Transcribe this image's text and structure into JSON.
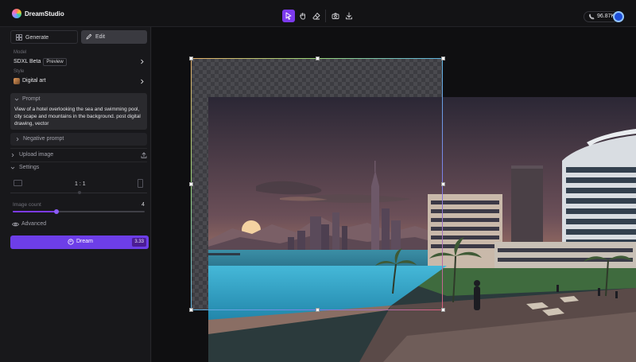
{
  "app": {
    "name": "DreamStudio"
  },
  "toolbar": {
    "tools": [
      {
        "name": "select-tool",
        "icon": "cursor-icon",
        "active": true
      },
      {
        "name": "pan-tool",
        "icon": "hand-icon",
        "active": false
      },
      {
        "name": "eraser-tool",
        "icon": "eraser-icon",
        "active": false
      },
      {
        "name": "snapshot-tool",
        "icon": "camera-icon",
        "active": false
      },
      {
        "name": "download-tool",
        "icon": "download-icon",
        "active": false
      }
    ],
    "credits": "96.87K"
  },
  "sidebar": {
    "mode_generate": "Generate",
    "mode_edit": "Edit",
    "model_label": "Model",
    "model_value": "SDXL Beta",
    "model_badge": "Preview",
    "style_label": "Style",
    "style_value": "Digital art",
    "prompt_label": "Prompt",
    "prompt_text": "View of a hotel overlooking the sea and swimming pool, city scape and mountains in the background. post digital drawing, vector",
    "negative_prompt_label": "Negative prompt",
    "upload_label": "Upload image",
    "settings_label": "Settings",
    "aspect_ratio": "1 : 1",
    "image_count_label": "Image count",
    "image_count_value": "4",
    "image_count_fraction": 0.33,
    "advanced_label": "Advanced",
    "dream_label": "Dream",
    "dream_cost": "3.33"
  },
  "colors": {
    "accent": "#7c3aed",
    "dream_button": "#6d3ee8"
  }
}
